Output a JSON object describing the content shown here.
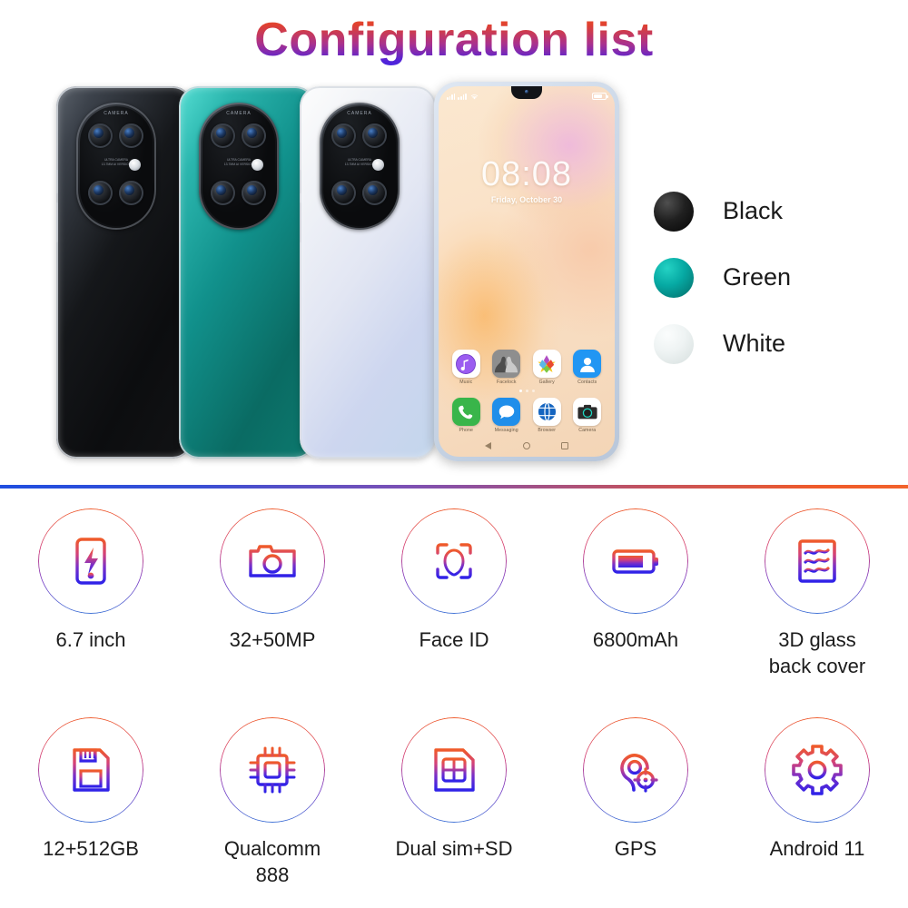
{
  "header": {
    "title": "Configuration list",
    "title_gradient_from": "#f0572c",
    "title_gradient_to": "#4628e0"
  },
  "colors": {
    "accent_orange": "#ef5a2a",
    "accent_blue": "#1f4ee0",
    "accent_purple": "#7a3bc4"
  },
  "phones": {
    "back_camera_label": "CAMERA",
    "back_camera_sub": "ULTRA CAMERA\n13.7MM AI VERSION",
    "variants": [
      {
        "name": "black",
        "color_hex": "#15171a"
      },
      {
        "name": "green",
        "color_hex": "#11918c"
      },
      {
        "name": "white",
        "color_hex": "#e2e6f3"
      }
    ]
  },
  "lockscreen": {
    "time": "08:08",
    "date": "Friday, October 30",
    "status_icons": [
      "signal-icon",
      "wifi-icon",
      "battery-icon"
    ],
    "apps_row1": [
      {
        "label": "Music",
        "icon": "music-icon"
      },
      {
        "label": "Facelock",
        "icon": "facelock-icon"
      },
      {
        "label": "Gallery",
        "icon": "gallery-icon"
      },
      {
        "label": "Contacts",
        "icon": "contacts-icon"
      }
    ],
    "apps_row2": [
      {
        "label": "Phone",
        "icon": "phone-icon"
      },
      {
        "label": "Messaging",
        "icon": "messaging-icon"
      },
      {
        "label": "Browser",
        "icon": "browser-icon"
      },
      {
        "label": "Camera",
        "icon": "camera-icon"
      }
    ],
    "nav": [
      "back-icon",
      "home-icon",
      "recents-icon"
    ]
  },
  "legend": {
    "items": [
      {
        "label": "Black",
        "swatch_from": "#4a4a4a",
        "swatch_to": "#0a0a0a"
      },
      {
        "label": "Green",
        "swatch_from": "#16bdb4",
        "swatch_to": "#0a6b63"
      },
      {
        "label": "White",
        "swatch_from": "#f4f7f7",
        "swatch_to": "#d6dede"
      }
    ]
  },
  "features": {
    "row1": [
      {
        "label": "6.7 inch",
        "icon": "screen-size-icon"
      },
      {
        "label": "32+50MP",
        "icon": "camera-icon"
      },
      {
        "label": "Face ID",
        "icon": "face-id-icon"
      },
      {
        "label": "6800mAh",
        "icon": "battery-icon"
      },
      {
        "label": "3D glass\nback cover",
        "icon": "glass-back-icon"
      }
    ],
    "row2": [
      {
        "label": "12+512GB",
        "icon": "storage-icon"
      },
      {
        "label": "Qualcomm\n888",
        "icon": "cpu-icon"
      },
      {
        "label": "Dual sim+SD",
        "icon": "sim-card-icon"
      },
      {
        "label": "GPS",
        "icon": "gps-icon"
      },
      {
        "label": "Android 11",
        "icon": "gear-icon"
      }
    ]
  }
}
